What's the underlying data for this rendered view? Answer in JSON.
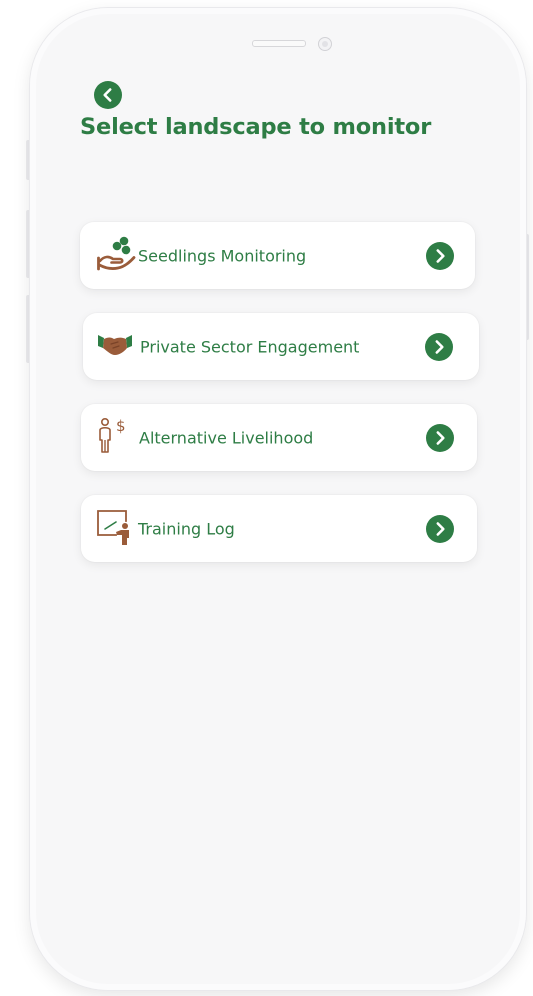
{
  "header": {
    "back_icon": "chevron-left-icon",
    "title": "Select landscape to monitor"
  },
  "colors": {
    "accent": "#2e7d45",
    "icon_brown": "#9a5c3a",
    "card_bg": "#ffffff"
  },
  "menu": {
    "items": [
      {
        "label": "Seedlings Monitoring",
        "icon": "seedlings-hand-icon"
      },
      {
        "label": "Private Sector Engagement",
        "icon": "handshake-icon"
      },
      {
        "label": "Alternative Livelihood",
        "icon": "person-dollar-icon"
      },
      {
        "label": "Training Log",
        "icon": "training-board-icon"
      }
    ],
    "arrow_icon": "chevron-right-icon"
  }
}
